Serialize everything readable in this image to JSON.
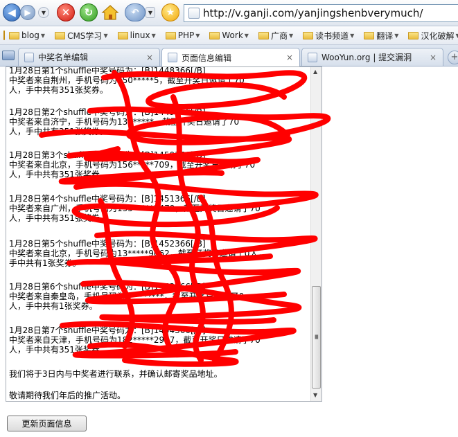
{
  "toolbar": {
    "back_icon": "back-arrow-icon",
    "forward_icon": "forward-arrow-icon",
    "stop_icon": "stop-icon",
    "refresh_icon": "refresh-icon",
    "home_icon": "home-icon",
    "undo_icon": "undo-icon",
    "favorite_icon": "star-icon",
    "address": "http://v.ganji.com/yanjingshenbverymuch/"
  },
  "bookmarks": [
    {
      "label": "blog"
    },
    {
      "label": "CMS学习"
    },
    {
      "label": "linux"
    },
    {
      "label": "PHP"
    },
    {
      "label": "Work"
    },
    {
      "label": "广商"
    },
    {
      "label": "读书频道"
    },
    {
      "label": "翻译"
    },
    {
      "label": "汉化破解"
    }
  ],
  "tabs": [
    {
      "label": "中奖名单编辑",
      "close": "×"
    },
    {
      "label": "页面信息编辑",
      "close": "×"
    },
    {
      "label": "WooYun.org | 提交漏洞",
      "close": "×"
    }
  ],
  "content": {
    "entries": [
      {
        "line1": "1月28日第1个shuffle中奖号码为：[B]1448366[/B]",
        "line2": "中奖者来自荆州，手机号码为150*****5，截至开奖日邀请了70",
        "line3": "人，手中共有351张奖券。"
      },
      {
        "line1": "1月28日第2个shuffle中奖号码为：[B]1449366[/B]",
        "line2": "中奖者来自济宁，手机号码为134*****，截至开奖日邀请了70",
        "line3": "人，手中共有351张奖券。"
      },
      {
        "line1": "1月28日第3个shuffle中奖号码为：[B]1450366[/B]",
        "line2": "中奖者来自北京，手机号码为156*****709，截至开奖日邀请了70",
        "line3": "人，手中共有351张奖券。"
      },
      {
        "line1": "1月28日第4个shuffle中奖号码为：[B]1451366[/B]",
        "line2": "中奖者来自广州，手机号码为135*****5479，截至开奖日邀请了70",
        "line3": "人，手中共有351张奖券。"
      },
      {
        "line1": "1月28日第5个shuffle中奖号码为：[B]1452366[/B]",
        "line2": "中奖者来自北京，手机号码为13*****9062，截至开奖日邀请了0人，",
        "line3": "手中共有1张奖券。"
      },
      {
        "line1": "1月28日第6个shuffle中奖号码为：[B]1453366[/B]",
        "line2": "中奖者来自秦皇岛，手机号码为1********，截至开奖日邀请了0",
        "line3": "人，手中共有1张奖券。"
      },
      {
        "line1": "1月28日第7个shuffle中奖号码为：[B]1454366[/B]",
        "line2": "中奖者来自天津，手机号码为182*****2907，截至开奖日邀请了70",
        "line3": "人，手中共有351张奖券。"
      }
    ],
    "closing1": "我们将于3日内与中奖者进行联系，并确认邮寄奖品地址。",
    "closing2": "敬请期待我们年后的推广活动。"
  },
  "update_button": "更新页面信息",
  "scribble_color": "#ff0000"
}
